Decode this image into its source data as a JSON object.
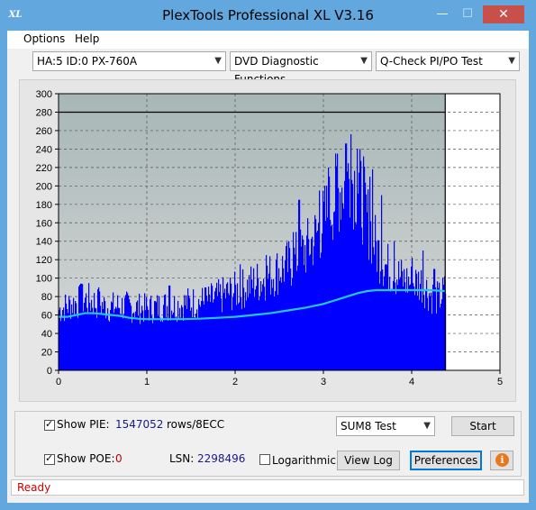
{
  "window": {
    "title": "PlexTools Professional XL V3.16",
    "app_icon_text": "XL",
    "minimize_glyph": "—",
    "maximize_glyph": "☐",
    "close_glyph": "✕"
  },
  "menu": [
    "Options",
    "Help"
  ],
  "toolbar": {
    "drive": "HA:5 ID:0  PX-760A",
    "function": "DVD Diagnostic Functions",
    "test": "Q-Check PI/PO Test"
  },
  "chart_data": {
    "type": "area",
    "ylim": [
      0,
      300
    ],
    "xlim": [
      0,
      5
    ],
    "yticks": [
      "0",
      "20",
      "40",
      "60",
      "80",
      "100",
      "120",
      "140",
      "160",
      "180",
      "200",
      "220",
      "240",
      "260",
      "280",
      "300"
    ],
    "xticks": [
      "0",
      "1",
      "2",
      "3",
      "4",
      "5"
    ],
    "threshold_line": 280,
    "data_end_x": 4.38,
    "plot_bg_top": "#a7b6b6",
    "plot_bg_bottom": "#dadada",
    "pie_color": "#0000ff",
    "sum_color": "#22c8e8",
    "pie_envelope": [
      [
        0,
        75
      ],
      [
        0.1,
        80
      ],
      [
        0.2,
        84
      ],
      [
        0.3,
        88
      ],
      [
        0.4,
        84
      ],
      [
        0.5,
        80
      ],
      [
        0.6,
        78
      ],
      [
        0.7,
        80
      ],
      [
        0.8,
        78
      ],
      [
        0.9,
        77
      ],
      [
        1.0,
        76
      ],
      [
        1.1,
        78
      ],
      [
        1.2,
        80
      ],
      [
        1.3,
        80
      ],
      [
        1.4,
        82
      ],
      [
        1.5,
        84
      ],
      [
        1.6,
        84
      ],
      [
        1.7,
        86
      ],
      [
        1.8,
        90
      ],
      [
        1.9,
        95
      ],
      [
        2.0,
        98
      ],
      [
        2.1,
        102
      ],
      [
        2.2,
        108
      ],
      [
        2.3,
        112
      ],
      [
        2.4,
        118
      ],
      [
        2.5,
        125
      ],
      [
        2.6,
        130
      ],
      [
        2.7,
        140
      ],
      [
        2.8,
        150
      ],
      [
        2.9,
        165
      ],
      [
        3.0,
        185
      ],
      [
        3.1,
        210
      ],
      [
        3.2,
        228
      ],
      [
        3.3,
        240
      ],
      [
        3.4,
        225
      ],
      [
        3.5,
        185
      ],
      [
        3.6,
        150
      ],
      [
        3.7,
        130
      ],
      [
        3.8,
        120
      ],
      [
        3.9,
        112
      ],
      [
        4.0,
        108
      ],
      [
        4.1,
        110
      ],
      [
        4.2,
        95
      ],
      [
        4.3,
        88
      ],
      [
        4.38,
        100
      ]
    ],
    "pie_spikes": [
      [
        0.25,
        94
      ],
      [
        0.45,
        90
      ],
      [
        1.25,
        92
      ],
      [
        1.65,
        90
      ],
      [
        2.05,
        115
      ],
      [
        2.35,
        125
      ],
      [
        2.65,
        150
      ],
      [
        2.72,
        185
      ],
      [
        2.95,
        195
      ],
      [
        3.05,
        220
      ],
      [
        3.15,
        235
      ],
      [
        3.25,
        246
      ],
      [
        3.31,
        256
      ],
      [
        3.38,
        240
      ],
      [
        3.45,
        232
      ],
      [
        3.52,
        210
      ],
      [
        3.55,
        218
      ],
      [
        3.65,
        190
      ],
      [
        3.8,
        140
      ],
      [
        4.0,
        122
      ],
      [
        4.12,
        130
      ],
      [
        4.25,
        110
      ]
    ],
    "sum8": [
      [
        0,
        58
      ],
      [
        0.1,
        58
      ],
      [
        0.2,
        60
      ],
      [
        0.3,
        62
      ],
      [
        0.4,
        62
      ],
      [
        0.5,
        61
      ],
      [
        0.6,
        60
      ],
      [
        0.7,
        59
      ],
      [
        0.8,
        57
      ],
      [
        0.9,
        56
      ],
      [
        1.0,
        55.5
      ],
      [
        1.2,
        55.5
      ],
      [
        1.4,
        55.5
      ],
      [
        1.6,
        56
      ],
      [
        1.8,
        57
      ],
      [
        2.0,
        58
      ],
      [
        2.2,
        60
      ],
      [
        2.4,
        62
      ],
      [
        2.6,
        65
      ],
      [
        2.8,
        68
      ],
      [
        3.0,
        72
      ],
      [
        3.1,
        75
      ],
      [
        3.2,
        78
      ],
      [
        3.3,
        81
      ],
      [
        3.4,
        84
      ],
      [
        3.5,
        86
      ],
      [
        3.6,
        87
      ],
      [
        3.8,
        87
      ],
      [
        4.0,
        87
      ],
      [
        4.2,
        87
      ],
      [
        4.38,
        86
      ]
    ]
  },
  "panel": {
    "show_pie_label": "Show PIE:",
    "pie_value": "1547052",
    "pie_unit": "rows/8ECC",
    "show_poe_label": "Show POE:",
    "poe_value": "0",
    "lsn_label": "LSN:",
    "lsn_value": "2298496",
    "log_label": "Logarithmic",
    "sum_select": "SUM8 Test",
    "start_button": "Start",
    "viewlog_button": "View Log",
    "prefs_button": "Preferences",
    "info_glyph": "i"
  },
  "status": "Ready"
}
